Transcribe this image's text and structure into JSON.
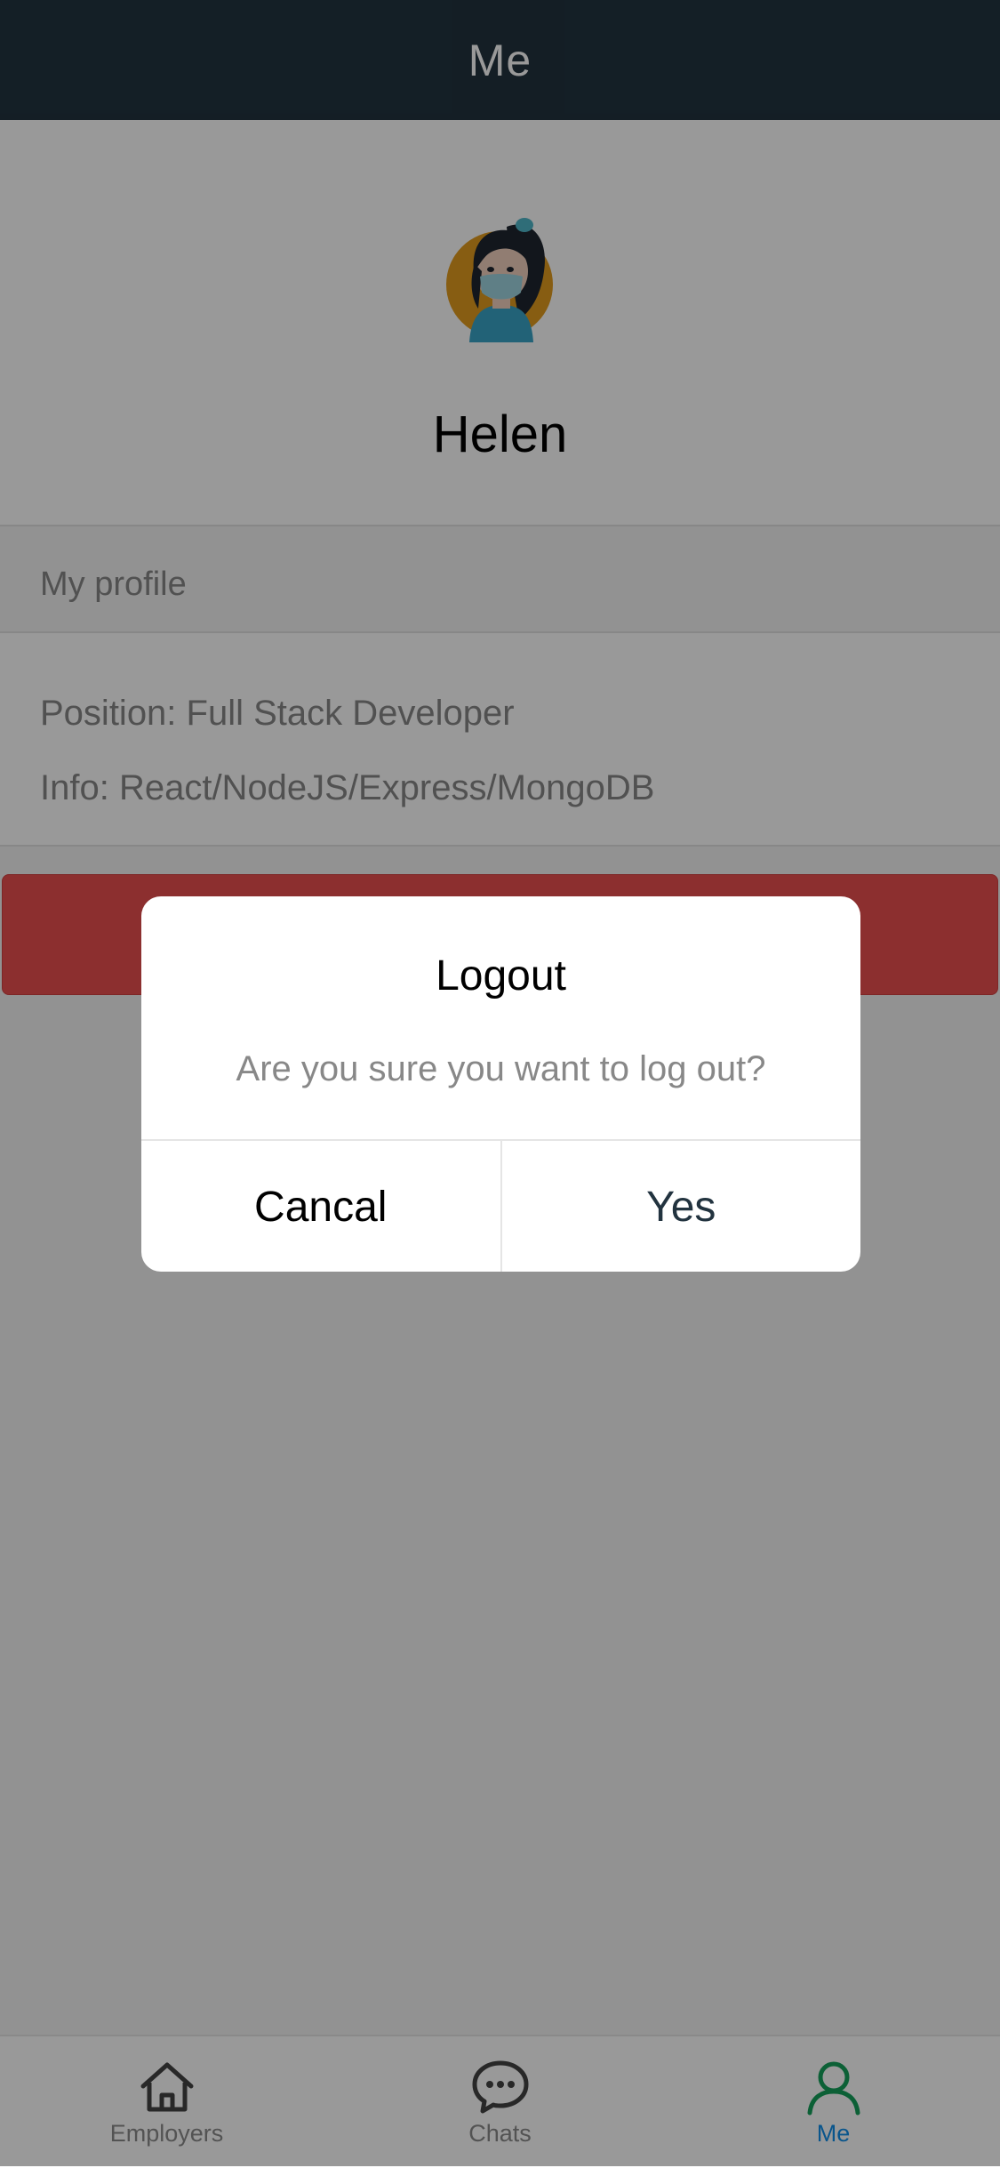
{
  "header": {
    "title": "Me"
  },
  "profile": {
    "avatar_icon": "female-avatar-with-mask",
    "name": "Helen"
  },
  "section": {
    "title": "My profile"
  },
  "details": {
    "position": "Position: Full Stack Developer",
    "info": "Info: React/NodeJS/Express/MongoDB"
  },
  "colors": {
    "header_bg": "#22333f",
    "logout_button": "#e94f4f",
    "active_tab": "#108ee9",
    "active_icon": "#15a05a",
    "confirm_text": "#22333f"
  },
  "modal": {
    "title": "Logout",
    "message": "Are you sure you want to log out?",
    "cancel_label": "Cancal",
    "confirm_label": "Yes"
  },
  "tabbar": {
    "items": [
      {
        "label": "Employers",
        "icon": "home-icon",
        "active": false
      },
      {
        "label": "Chats",
        "icon": "chat-icon",
        "active": false
      },
      {
        "label": "Me",
        "icon": "user-icon",
        "active": true
      }
    ]
  }
}
